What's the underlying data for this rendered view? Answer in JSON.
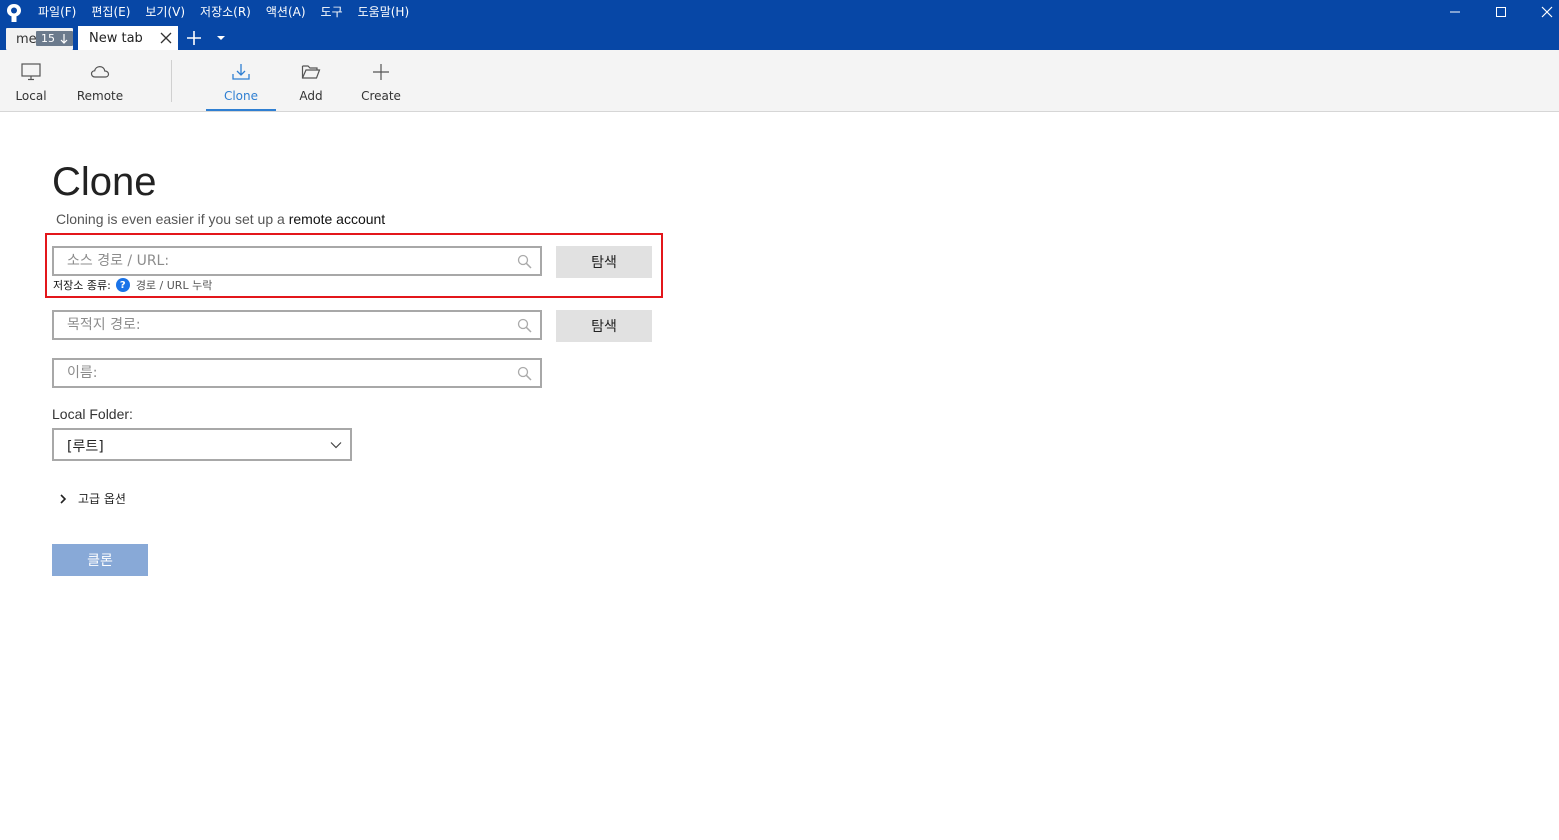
{
  "menu": {
    "items": [
      "파일(F)",
      "편집(E)",
      "보기(V)",
      "저장소(R)",
      "액션(A)",
      "도구",
      "도움말(H)"
    ]
  },
  "tabs": {
    "repo_tab": {
      "name": "me",
      "badge_count": "15"
    },
    "new_tab": {
      "label": "New tab"
    }
  },
  "toolbar": {
    "local": "Local",
    "remote": "Remote",
    "clone": "Clone",
    "add": "Add",
    "create": "Create",
    "active": "Clone"
  },
  "main": {
    "title": "Clone",
    "subtitle_prefix": "Cloning is even easier if you set up a ",
    "subtitle_link": "remote account",
    "source": {
      "placeholder": "소스 경로 / URL:",
      "value": ""
    },
    "browse_label": "탐색",
    "repo_type": {
      "label": "저장소 종류:",
      "help": "?",
      "value": "경로 / URL 누락"
    },
    "destination": {
      "placeholder": "목적지 경로:",
      "value": ""
    },
    "name": {
      "placeholder": "이름:",
      "value": ""
    },
    "local_folder": {
      "label": "Local Folder:",
      "selected": "[루트]"
    },
    "advanced_label": "고급 옵션",
    "clone_button": "클론"
  },
  "colors": {
    "titlebar": "#0747a6",
    "accent": "#2f7fd2",
    "highlight": "#e3161b",
    "clone_button": "#88a9d7"
  }
}
